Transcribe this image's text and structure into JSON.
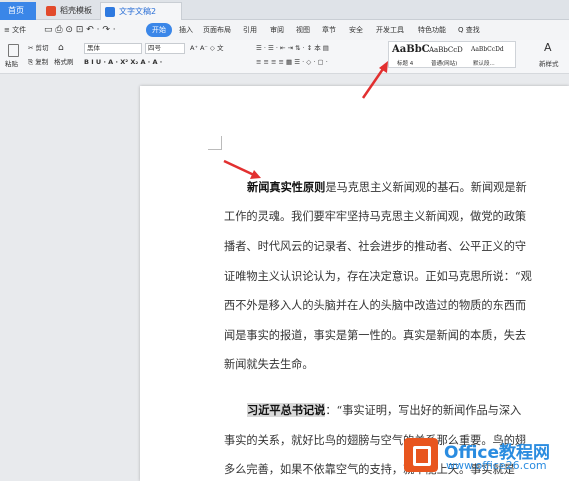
{
  "tabs": {
    "home": "首页",
    "template": "稻壳模板",
    "document": "文字文稿2"
  },
  "menu": {
    "file": "≡ 文件",
    "items": [
      "开始",
      "插入",
      "页面布局",
      "引用",
      "审阅",
      "视图",
      "章节",
      "安全",
      "开发工具",
      "特色功能"
    ],
    "active": "开始",
    "search": "Q 查找"
  },
  "toolbar": {
    "paste": "粘贴",
    "cut": "剪切",
    "copy": "复制",
    "format_painter": "格式刷",
    "font_name": "黑体",
    "font_size": "四号",
    "font_buttons": "A⁺ A⁻ ◇ 文",
    "format_buttons": "B I U · A · X² X₂ A · A ·",
    "para_row1": "☰ · ☰ · ⇤ ⇥ ⇅ · ↕ 本 ▤",
    "para_row2": "≡ ≡ ≡ ≡ ▦ ☰ · ◇ · ▢ ·",
    "new_style": "新样式"
  },
  "styles": [
    {
      "sample": "AaBbC",
      "caption": "标题 4"
    },
    {
      "sample": "AaBbCcD",
      "caption": "普通(网站)"
    },
    {
      "sample": "AaBbCcDd",
      "caption": "默认段..."
    }
  ],
  "doc": {
    "p1_bold": "新闻真实性原则",
    "p1_rest": "是马克思主义新闻观的基石。新闻观是新",
    "p1_lines": [
      "工作的灵魂。我们要牢牢坚持马克思主义新闻观，做党的政策",
      "播者、时代风云的记录者、社会进步的推动者、公平正义的守",
      "证唯物主义认识论认为，存在决定意识。正如马克思所说：“观",
      "西不外是移入人的头脑并在人的头脑中改造过的物质的东西而",
      "闻是事实的报道，事实是第一性的。真实是新闻的本质，失去",
      "新闻就失去生命。"
    ],
    "p2_bold": "习近平总书记说",
    "p2_rest": "：“事实证明，写出好的新闻作品与深入",
    "p2_lines": [
      "事实的关系，就好比鸟的翅膀与空气的关系那么重要。鸟的翅",
      "多么完善，如果不依靠空气的支持，就不能上天。事实就是"
    ]
  },
  "watermark": {
    "brand": "Office教程网",
    "url": "www.office26.com"
  },
  "colors": {
    "accent": "#3a86e8",
    "arrow": "#e23030",
    "logo_orange": "#e8551e",
    "logo_blue": "#2a8ce0"
  }
}
